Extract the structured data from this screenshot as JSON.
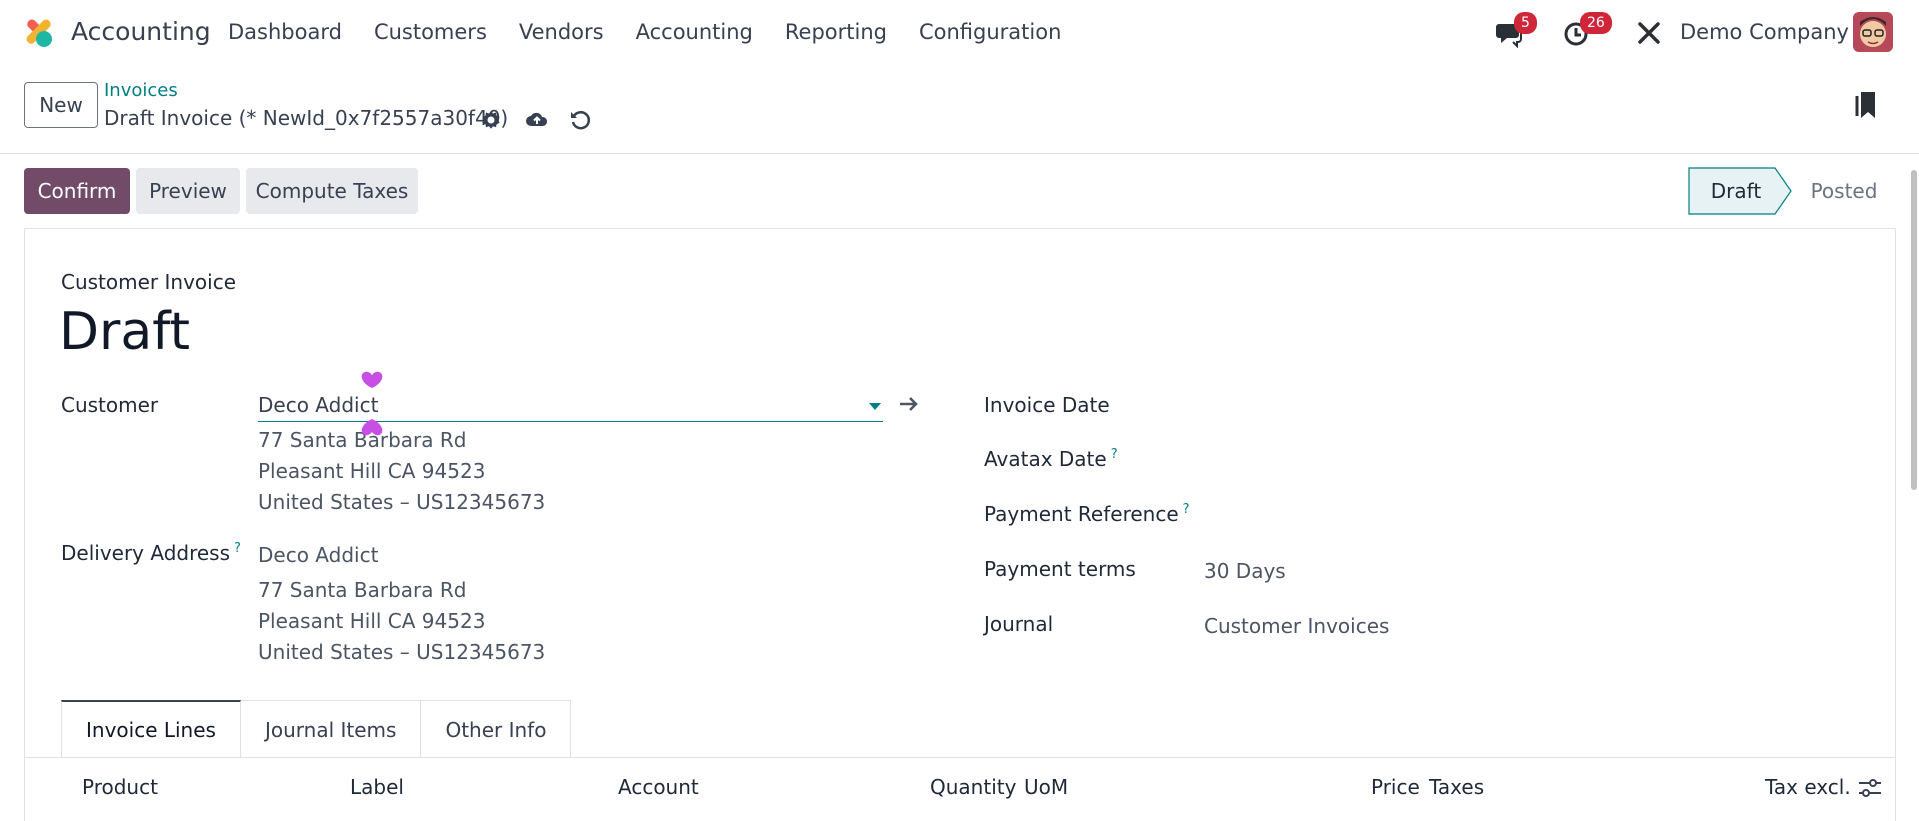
{
  "app": {
    "name": "Accounting"
  },
  "menu": [
    "Dashboard",
    "Customers",
    "Vendors",
    "Accounting",
    "Reporting",
    "Configuration"
  ],
  "navbar": {
    "messages_count": "5",
    "activities_count": "26",
    "company": "Demo Company"
  },
  "control": {
    "new_label": "New",
    "breadcrumb": "Invoices",
    "record_title": "Draft Invoice (* NewId_0x7f2557a30f40)"
  },
  "actions": {
    "confirm": "Confirm",
    "preview": "Preview",
    "compute_taxes": "Compute Taxes"
  },
  "statusbar": {
    "stages": [
      "Draft",
      "Posted"
    ],
    "current": "Draft"
  },
  "form": {
    "subtitle": "Customer Invoice",
    "title": "Draft",
    "customer_label": "Customer",
    "customer_value": "Deco Addict",
    "customer_address": [
      "77 Santa Barbara Rd",
      "Pleasant Hill CA 94523",
      "United States – US12345673"
    ],
    "delivery_label": "Delivery Address",
    "delivery_name": "Deco Addict",
    "delivery_address": [
      "77 Santa Barbara Rd",
      "Pleasant Hill CA 94523",
      "United States – US12345673"
    ],
    "help_mark": "?",
    "invoice_date_label": "Invoice Date",
    "avatax_date_label": "Avatax Date",
    "payment_reference_label": "Payment Reference",
    "payment_terms_label": "Payment terms",
    "payment_terms_value": "30 Days",
    "journal_label": "Journal",
    "journal_value": "Customer Invoices"
  },
  "tabs": [
    "Invoice Lines",
    "Journal Items",
    "Other Info"
  ],
  "columns": [
    "Product",
    "Label",
    "Account",
    "Quantity",
    "UoM",
    "Price",
    "Taxes",
    "Tax excl."
  ],
  "colors": {
    "primary": "#714b67",
    "link": "#017e84",
    "badge": "#d0263a",
    "marker": "#c84fe6"
  }
}
